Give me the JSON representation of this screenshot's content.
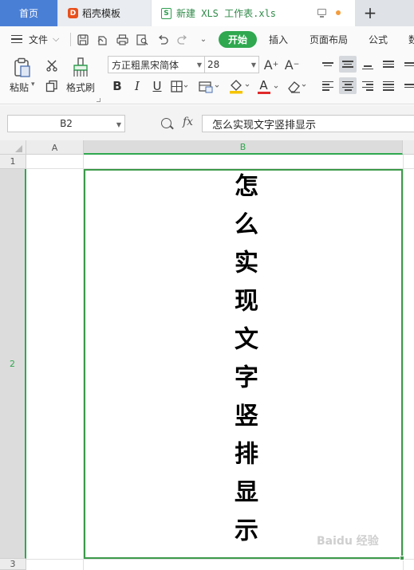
{
  "tabs": {
    "home": "首页",
    "template": "稻壳模板",
    "template_logo": "D",
    "document": "新建 XLS 工作表.xls",
    "document_logo": "S",
    "new_tab": "+"
  },
  "menu": {
    "file": "文件",
    "start": "开始",
    "insert": "插入",
    "page_layout": "页面布局",
    "formulas": "公式",
    "more": "数"
  },
  "ribbon": {
    "paste": "粘贴",
    "format_painter": "格式刷",
    "font_name": "方正粗黑宋简体",
    "font_size": "28",
    "bold": "B",
    "italic": "I",
    "underline": "U",
    "increase_font": "A⁺",
    "decrease_font": "A⁻",
    "font_color_glyph": "A"
  },
  "formula_bar": {
    "cell_ref": "B2",
    "fx": "fx",
    "content": "怎么实现文字竖排显示"
  },
  "sheet": {
    "columns": [
      "A",
      "B"
    ],
    "rows": [
      "1",
      "2",
      "3"
    ],
    "selected_cell": "B2",
    "cell_b2_text": "怎么实现文字竖排显示"
  },
  "watermark": "Baidu 经验",
  "colors": {
    "accent_green": "#2fa84f",
    "tab_blue": "#4a7fd6",
    "selection_border": "#3c9a4a"
  }
}
